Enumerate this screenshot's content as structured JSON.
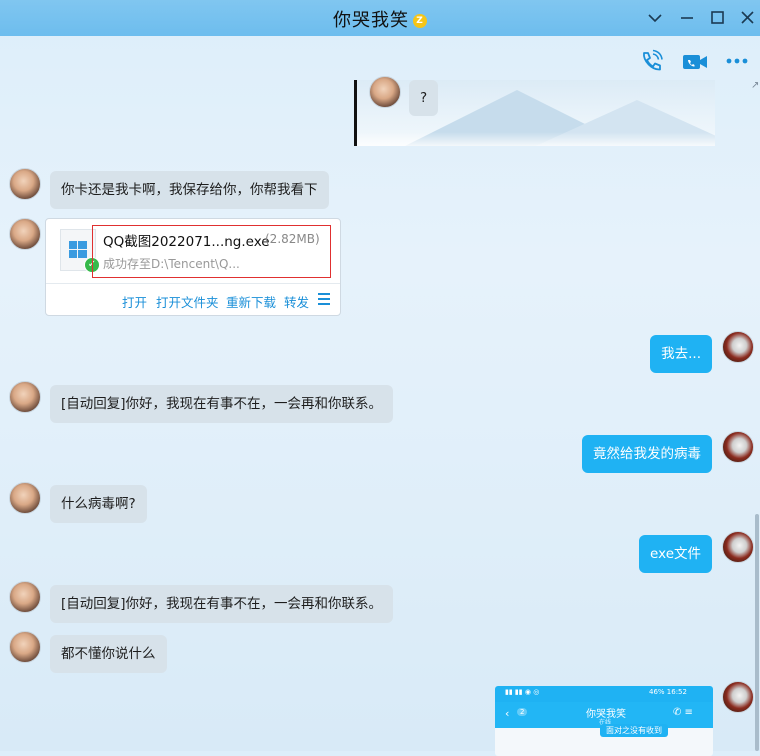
{
  "window": {
    "title": "你哭我笑",
    "title_badge": "Z",
    "controls": [
      "chevron-down-icon",
      "minimize-icon",
      "maximize-icon",
      "close-icon"
    ]
  },
  "toolbar": {
    "icons": [
      "phone-call-icon",
      "video-call-icon",
      "more-icon"
    ],
    "accent_color": "#1a8fd8"
  },
  "messages": [
    {
      "side": "out",
      "type": "text",
      "text": "?"
    },
    {
      "side": "in",
      "type": "text",
      "text": "你卡还是我卡啊，我保存给你，你帮我看下"
    },
    {
      "side": "in",
      "type": "file",
      "file": {
        "name": "QQ截图2022071...ng.exe",
        "size": "(2.82MB)",
        "status": "成功存至D:\\Tencent\\Q...",
        "actions": [
          "打开",
          "打开文件夹",
          "重新下载",
          "转发"
        ]
      }
    },
    {
      "side": "out",
      "type": "text",
      "text": "我去..."
    },
    {
      "side": "in",
      "type": "text",
      "text": "[自动回复]你好，我现在有事不在，一会再和你联系。"
    },
    {
      "side": "out",
      "type": "text",
      "text": "竟然给我发的病毒"
    },
    {
      "side": "in",
      "type": "text",
      "text": "什么病毒啊?"
    },
    {
      "side": "out",
      "type": "text",
      "text": "exe文件"
    },
    {
      "side": "in",
      "type": "text",
      "text": "[自动回复]你好，我现在有事不在，一会再和你联系。"
    },
    {
      "side": "in",
      "type": "text",
      "text": "都不懂你说什么"
    }
  ],
  "phone_screenshot": {
    "status_right": "46% 16:52",
    "title": "你哭我笑",
    "subtitle": "在线",
    "badge": "2",
    "bubble_text": "面对之没有收到"
  },
  "colors": {
    "outgoing_bubble": "#1fb2f3",
    "incoming_bubble": "#d7e2ea",
    "titlebar": "#6dbdee"
  }
}
